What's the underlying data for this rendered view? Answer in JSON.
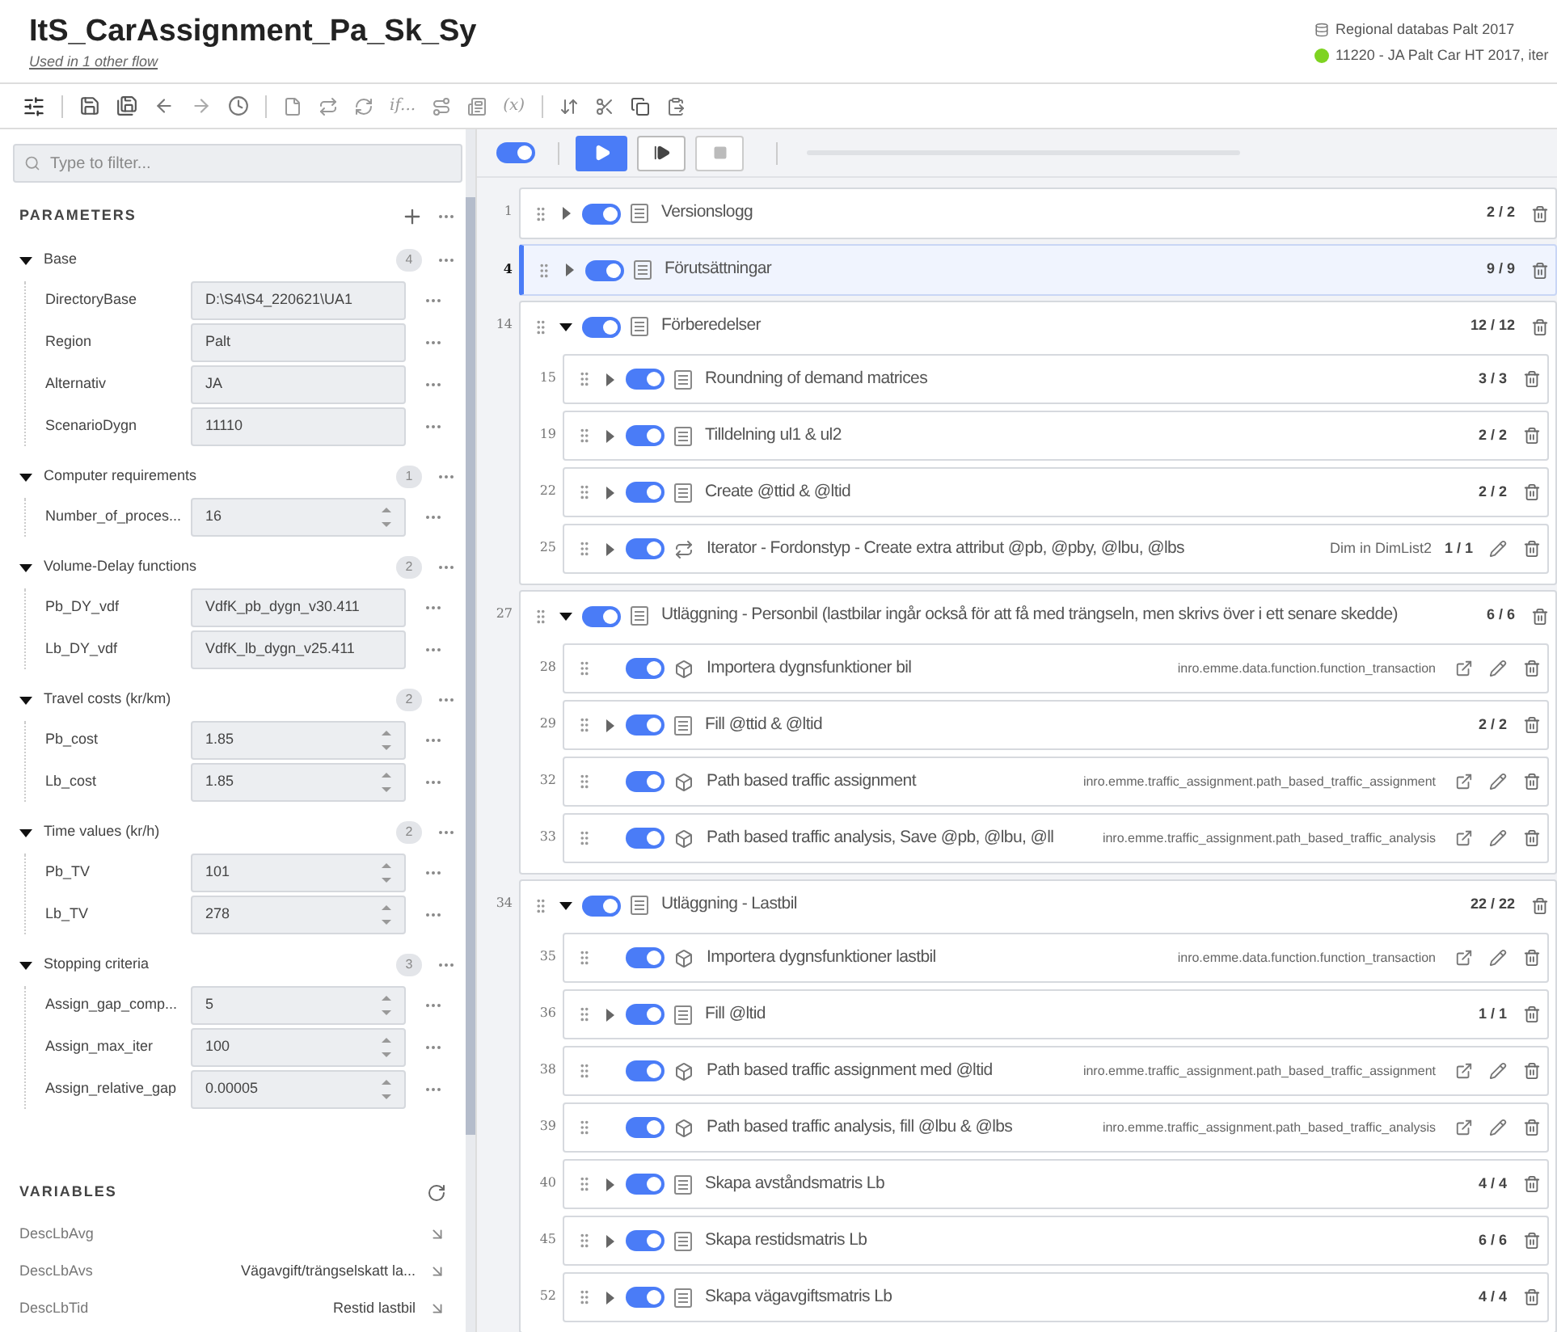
{
  "header": {
    "title": "ItS_CarAssignment_Pa_Sk_Sy",
    "subtitle_link": "Used in 1 other flow",
    "database": "Regional databas Palt 2017",
    "status": {
      "label": "11220 - JA Palt Car HT 2017, iter",
      "color": "#7ed321"
    }
  },
  "toolbar": {
    "condition_label": "if...",
    "variable_label": "(x)"
  },
  "filter": {
    "placeholder": "Type to filter..."
  },
  "parameters": {
    "title": "PARAMETERS",
    "groups": [
      {
        "name": "Base",
        "count": "4",
        "expanded": true,
        "params": [
          {
            "name": "DirectoryBase",
            "value": "D:\\S4\\S4_220621\\UA1",
            "kind": "text"
          },
          {
            "name": "Region",
            "value": "Palt",
            "kind": "text"
          },
          {
            "name": "Alternativ",
            "value": "JA",
            "kind": "text"
          },
          {
            "name": "ScenarioDygn",
            "value": "11110",
            "kind": "text"
          }
        ]
      },
      {
        "name": "Computer requirements",
        "count": "1",
        "expanded": true,
        "params": [
          {
            "name": "Number_of_proces...",
            "value": "16",
            "kind": "number"
          }
        ]
      },
      {
        "name": "Volume-Delay functions",
        "count": "2",
        "expanded": true,
        "params": [
          {
            "name": "Pb_DY_vdf",
            "value": "VdfK_pb_dygn_v30.411",
            "kind": "text"
          },
          {
            "name": "Lb_DY_vdf",
            "value": "VdfK_lb_dygn_v25.411",
            "kind": "text"
          }
        ]
      },
      {
        "name": "Travel costs (kr/km)",
        "count": "2",
        "expanded": true,
        "params": [
          {
            "name": "Pb_cost",
            "value": "1.85",
            "kind": "number"
          },
          {
            "name": "Lb_cost",
            "value": "1.85",
            "kind": "number"
          }
        ]
      },
      {
        "name": "Time values (kr/h)",
        "count": "2",
        "expanded": true,
        "params": [
          {
            "name": "Pb_TV",
            "value": "101",
            "kind": "number"
          },
          {
            "name": "Lb_TV",
            "value": "278",
            "kind": "number"
          }
        ]
      },
      {
        "name": "Stopping criteria",
        "count": "3",
        "expanded": true,
        "params": [
          {
            "name": "Assign_gap_comp...",
            "value": "5",
            "kind": "number"
          },
          {
            "name": "Assign_max_iter",
            "value": "100",
            "kind": "number"
          },
          {
            "name": "Assign_relative_gap",
            "value": "0.00005",
            "kind": "number"
          }
        ]
      }
    ]
  },
  "variables": {
    "title": "VARIABLES",
    "items": [
      {
        "name": "DescLbAvg"
      },
      {
        "name": "DescLbAvs",
        "value": "Vägavgift/trängselskatt la..."
      },
      {
        "name": "DescLbTid",
        "value": "Restid lastbil"
      }
    ]
  },
  "run_bar": {
    "enabled": true,
    "progress": {
      "level": 0
    }
  },
  "flow": [
    {
      "number": "1",
      "title": "Versionslogg",
      "kind": "group",
      "expanded": false,
      "enabled": true,
      "selected": false,
      "count": "2 / 2"
    },
    {
      "number": "4",
      "title": "Förutsättningar",
      "kind": "group",
      "expanded": false,
      "enabled": true,
      "selected": true,
      "count": "9 / 9"
    },
    {
      "number": "14",
      "title": "Förberedelser",
      "kind": "group",
      "expanded": true,
      "enabled": true,
      "selected": false,
      "count": "12 / 12",
      "children": [
        {
          "number": "15",
          "title": "Roundning of demand matrices",
          "kind": "group",
          "expanded": false,
          "enabled": true,
          "selected": false,
          "count": "3 / 3"
        },
        {
          "number": "19",
          "title": "Tilldelning ul1 & ul2",
          "kind": "group",
          "expanded": false,
          "enabled": true,
          "selected": false,
          "count": "2 / 2"
        },
        {
          "number": "22",
          "title": "Create @ttid & @ltid",
          "kind": "group",
          "expanded": false,
          "enabled": true,
          "selected": false,
          "count": "2 / 2"
        },
        {
          "number": "25",
          "title": "Iterator - Fordonstyp  - Create extra attribut @pb, @pby, @lbu, @lbs",
          "kind": "iterator",
          "expanded": false,
          "enabled": true,
          "selected": false,
          "detail": "Dim in DimList2",
          "count": "1 / 1"
        }
      ]
    },
    {
      "number": "27",
      "title": "Utläggning - Personbil (lastbilar ingår också för att få med trängseln, men skrivs över i ett senare skedde)",
      "kind": "group",
      "expanded": true,
      "enabled": true,
      "selected": false,
      "count": "6 / 6",
      "children": [
        {
          "number": "28",
          "title": "Importera dygnsfunktioner bil",
          "kind": "tool",
          "enabled": true,
          "selected": false,
          "detail": "inro.emme.data.function.function_transaction"
        },
        {
          "number": "29",
          "title": "Fill @ttid & @ltid",
          "kind": "group",
          "expanded": false,
          "enabled": true,
          "selected": false,
          "count": "2 / 2"
        },
        {
          "number": "32",
          "title": "Path based traffic assignment",
          "kind": "tool",
          "enabled": true,
          "selected": false,
          "detail": "inro.emme.traffic_assignment.path_based_traffic_assignment"
        },
        {
          "number": "33",
          "title": "Path based traffic analysis, Save @pb, @lbu, @ll",
          "kind": "tool",
          "enabled": true,
          "selected": false,
          "detail": "inro.emme.traffic_assignment.path_based_traffic_analysis"
        }
      ]
    },
    {
      "number": "34",
      "title": "Utläggning - Lastbil",
      "kind": "group",
      "expanded": true,
      "enabled": true,
      "selected": false,
      "count": "22 / 22",
      "children": [
        {
          "number": "35",
          "title": "Importera dygnsfunktioner lastbil",
          "kind": "tool",
          "enabled": true,
          "selected": false,
          "detail": "inro.emme.data.function.function_transaction"
        },
        {
          "number": "36",
          "title": "Fill @ltid",
          "kind": "group",
          "expanded": false,
          "enabled": true,
          "selected": false,
          "count": "1 / 1"
        },
        {
          "number": "38",
          "title": "Path based traffic assignment med @ltid",
          "kind": "tool",
          "enabled": true,
          "selected": false,
          "detail": "inro.emme.traffic_assignment.path_based_traffic_assignment"
        },
        {
          "number": "39",
          "title": "Path based traffic analysis, fill @lbu & @lbs",
          "kind": "tool",
          "enabled": true,
          "selected": false,
          "detail": "inro.emme.traffic_assignment.path_based_traffic_analysis"
        },
        {
          "number": "40",
          "title": "Skapa avståndsmatris Lb",
          "kind": "group",
          "expanded": false,
          "enabled": true,
          "selected": false,
          "count": "4 / 4"
        },
        {
          "number": "45",
          "title": "Skapa restidsmatris Lb",
          "kind": "group",
          "expanded": false,
          "enabled": true,
          "selected": false,
          "count": "6 / 6"
        },
        {
          "number": "52",
          "title": "Skapa vägavgiftsmatris Lb",
          "kind": "group",
          "expanded": false,
          "enabled": true,
          "selected": false,
          "count": "4 / 4"
        }
      ]
    }
  ]
}
